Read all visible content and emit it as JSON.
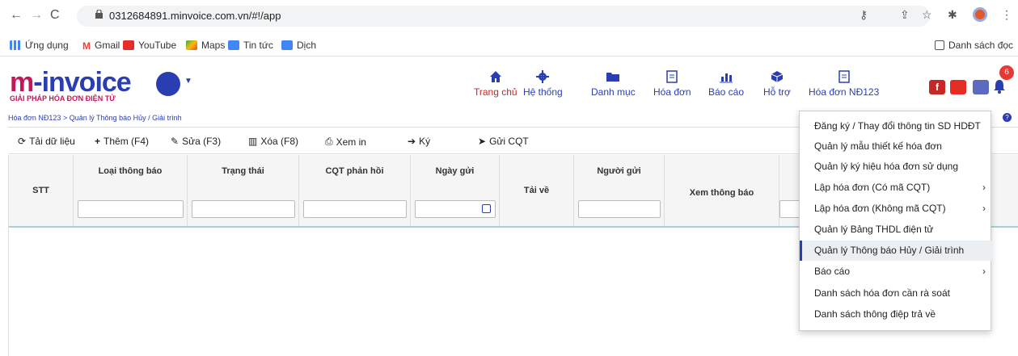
{
  "browser": {
    "url": "0312684891.minvoice.com.vn/#!/app",
    "bookmarks": [
      "Ứng dụng",
      "Gmail",
      "YouTube",
      "Maps",
      "Tin tức",
      "Dịch"
    ],
    "reading_list": "Danh sách đọc"
  },
  "header": {
    "logo_main": "invoice",
    "logo_tagline": "GIẢI PHÁP HÓA ĐƠN ĐIỆN TỬ",
    "nav": [
      {
        "label": "Trang chủ",
        "icon": "home-icon"
      },
      {
        "label": "Hệ thống",
        "icon": "gear-icon"
      },
      {
        "label": "Danh mục",
        "icon": "folder-icon"
      },
      {
        "label": "Hóa đơn",
        "icon": "document-icon"
      },
      {
        "label": "Báo cáo",
        "icon": "bar-chart-icon"
      },
      {
        "label": "Hỗ trợ",
        "icon": "cube-icon"
      },
      {
        "label": "Hóa đơn NĐ123",
        "icon": "document-icon"
      }
    ],
    "notification_count": "6"
  },
  "breadcrumb": "Hóa đơn NĐ123 > Quản lý Thông báo Hủy / Giải trình",
  "toolbar": [
    {
      "label": "Tải dữ liệu",
      "icon": "refresh-icon"
    },
    {
      "label": "Thêm (F4)",
      "icon": "plus-icon"
    },
    {
      "label": "Sửa (F3)",
      "icon": "edit-icon"
    },
    {
      "label": "Xóa (F8)",
      "icon": "trash-icon"
    },
    {
      "label": "Xem in",
      "icon": "print-icon"
    },
    {
      "label": "Ký",
      "icon": "sign-in-icon"
    },
    {
      "label": "Gửi CQT",
      "icon": "send-icon"
    }
  ],
  "grid": {
    "columns": [
      "STT",
      "Loại thông báo",
      "Trạng thái",
      "CQT phản hồi",
      "Ngày gửi",
      "Tải về",
      "Người gửi",
      "Xem thông báo"
    ]
  },
  "dropdown": {
    "items": [
      {
        "label": "Đăng ký / Thay đổi thông tin SD HDĐT",
        "submenu": false
      },
      {
        "label": "Quản lý mẫu thiết kế hóa đơn",
        "submenu": false
      },
      {
        "label": "Quản lý ký hiệu hóa đơn sử dụng",
        "submenu": false
      },
      {
        "label": "Lập hóa đơn (Có mã CQT)",
        "submenu": true
      },
      {
        "label": "Lập hóa đơn (Không mã CQT)",
        "submenu": true
      },
      {
        "label": "Quản lý Bảng THDL điện tử",
        "submenu": false
      },
      {
        "label": "Quản lý Thông báo Hủy / Giải trình",
        "submenu": false
      },
      {
        "label": "Báo cáo",
        "submenu": true
      },
      {
        "label": "Danh sách hóa đơn cần rà soát",
        "submenu": false
      },
      {
        "label": "Danh sách thông điệp trả về",
        "submenu": false
      }
    ],
    "selected_index": 6
  },
  "colors": {
    "brand": "#2a3eb1",
    "accent": "#c62828"
  }
}
